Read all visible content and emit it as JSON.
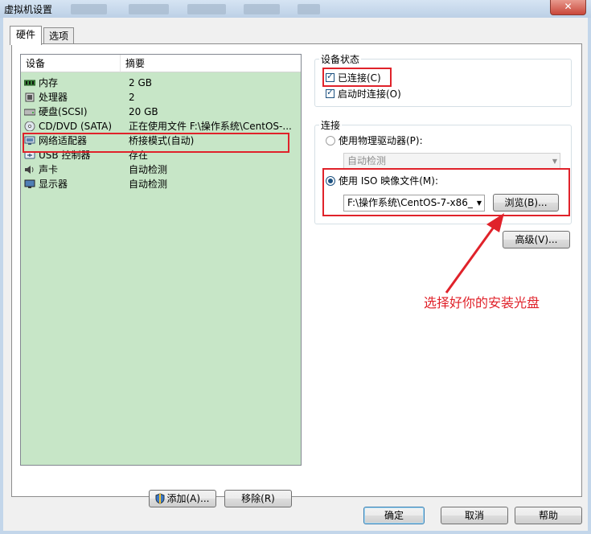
{
  "window": {
    "title": "虚拟机设置",
    "close_glyph": "✕"
  },
  "tabs": [
    {
      "label": "硬件"
    },
    {
      "label": "选项"
    }
  ],
  "device_list": {
    "col_device": "设备",
    "col_summary": "摘要",
    "rows": [
      {
        "name": "内存",
        "summary": "2 GB",
        "icon": "memory-icon"
      },
      {
        "name": "处理器",
        "summary": "2",
        "icon": "cpu-icon"
      },
      {
        "name": "硬盘(SCSI)",
        "summary": "20 GB",
        "icon": "harddisk-icon"
      },
      {
        "name": "CD/DVD (SATA)",
        "summary": "正在使用文件 F:\\操作系统\\CentOS-...",
        "icon": "cdrom-icon"
      },
      {
        "name": "网络适配器",
        "summary": "桥接模式(自动)",
        "icon": "network-icon"
      },
      {
        "name": "USB 控制器",
        "summary": "存在",
        "icon": "usb-icon"
      },
      {
        "name": "声卡",
        "summary": "自动检测",
        "icon": "speaker-icon"
      },
      {
        "name": "显示器",
        "summary": "自动检测",
        "icon": "monitor-icon"
      }
    ]
  },
  "buttons": {
    "add": "添加(A)...",
    "add_key": "A",
    "remove": "移除(R)",
    "remove_key": "R",
    "ok": "确定",
    "cancel": "取消",
    "help": "帮助",
    "browse": "浏览(B)...",
    "browse_key": "B",
    "advanced": "高级(V)...",
    "advanced_key": "V"
  },
  "device_status": {
    "label": "设备状态",
    "connected": {
      "label": "已连接(C)",
      "key": "C",
      "checked": true
    },
    "connect_at_power_on": {
      "label": "启动时连接(O)",
      "key": "O",
      "checked": true
    }
  },
  "connection": {
    "label": "连接",
    "physical": {
      "label": "使用物理驱动器(P):",
      "key": "P",
      "selected": false,
      "dropdown_value": "自动检测"
    },
    "iso": {
      "label": "使用 ISO 映像文件(M):",
      "key": "M",
      "selected": true,
      "path": "F:\\操作系统\\CentOS-7-x86_"
    }
  },
  "annotation": {
    "text": "选择好你的安装光盘",
    "color": "#e0222a"
  },
  "colors": {
    "list_bg": "#c7e6c7",
    "highlight_red": "#e0222a",
    "title_bar": "#c3d6ea"
  }
}
